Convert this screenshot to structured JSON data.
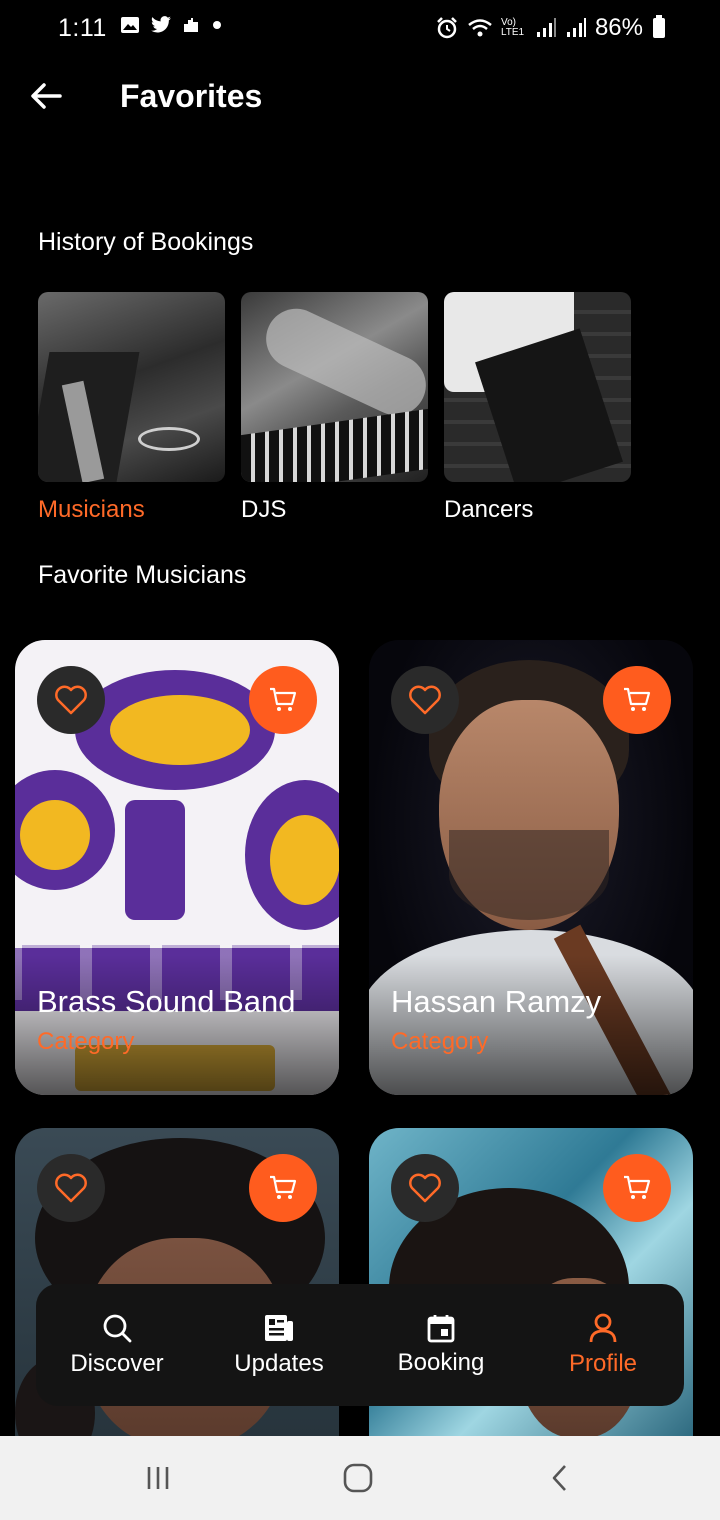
{
  "status_bar": {
    "time": "1:11",
    "network_label": "Vo) LTE1",
    "battery": "86%"
  },
  "header": {
    "title": "Favorites"
  },
  "history": {
    "title": "History of Bookings",
    "items": [
      {
        "label": "Musicians",
        "active": true
      },
      {
        "label": "DJS",
        "active": false
      },
      {
        "label": "Dancers",
        "active": false
      }
    ]
  },
  "favorites": {
    "title": "Favorite Musicians",
    "cards": [
      {
        "name": "Brass Sound Band",
        "category": "Category"
      },
      {
        "name": "Hassan Ramzy",
        "category": "Category"
      },
      {
        "name": "",
        "category": ""
      },
      {
        "name": "",
        "category": ""
      }
    ]
  },
  "bottom_nav": {
    "items": [
      {
        "label": "Discover",
        "icon": "search-icon"
      },
      {
        "label": "Updates",
        "icon": "newspaper-icon"
      },
      {
        "label": "Booking",
        "icon": "calendar-icon"
      },
      {
        "label": "Profile",
        "icon": "person-icon",
        "active": true
      }
    ]
  },
  "colors": {
    "accent": "#ff6a28",
    "background": "#000000",
    "card_button": "#2a2a2a"
  }
}
